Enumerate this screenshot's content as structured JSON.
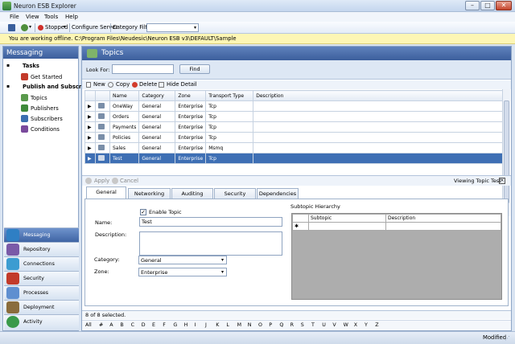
{
  "window": {
    "title": "Neuron ESB Explorer",
    "minimize": "–",
    "maximize": "□",
    "close": "✕"
  },
  "menu": [
    "File",
    "View",
    "Tools",
    "Help"
  ],
  "toolbar": {
    "status": "Stopped",
    "configure_server": "Configure Server",
    "category_filter_label": "Category Filter",
    "category_filter_value": ""
  },
  "infobar": {
    "text": "You are working offline. C:\\Program Files\\Neudesic\\Neuron ESB v3\\DEFAULT\\Sample"
  },
  "sidebar": {
    "header": "Messaging",
    "tree": [
      {
        "label": "Tasks",
        "bold": true
      },
      {
        "label": "Get Started"
      },
      {
        "label": "Publish and Subscribe",
        "bold": true
      },
      {
        "label": "Topics"
      },
      {
        "label": "Publishers"
      },
      {
        "label": "Subscribers"
      },
      {
        "label": "Conditions"
      }
    ],
    "nav": [
      {
        "label": "Messaging",
        "color": "#2f7fc4"
      },
      {
        "label": "Repository",
        "color": "#7a5aa8"
      },
      {
        "label": "Connections",
        "color": "#3c9cd1"
      },
      {
        "label": "Security",
        "color": "#c23a2a"
      },
      {
        "label": "Processes",
        "color": "#5f8fd0"
      },
      {
        "label": "Deployment",
        "color": "#8a6c3c"
      },
      {
        "label": "Activity",
        "color": "#3a9a4a"
      }
    ]
  },
  "main": {
    "header": "Topics",
    "look_for_label": "Look For:",
    "look_for_value": "",
    "find_button": "Find",
    "grid_toolbar": {
      "new": "New",
      "copy": "Copy",
      "delete": "Delete",
      "hide_detail": "Hide Detail"
    },
    "columns": [
      "Name",
      "Category",
      "Zone",
      "Transport Type",
      "Description"
    ],
    "rows": [
      {
        "name": "OneWay",
        "category": "General",
        "zone": "Enterprise",
        "transport": "Tcp",
        "description": ""
      },
      {
        "name": "Orders",
        "category": "General",
        "zone": "Enterprise",
        "transport": "Tcp",
        "description": ""
      },
      {
        "name": "Payments",
        "category": "General",
        "zone": "Enterprise",
        "transport": "Tcp",
        "description": ""
      },
      {
        "name": "Policies",
        "category": "General",
        "zone": "Enterprise",
        "transport": "Tcp",
        "description": ""
      },
      {
        "name": "Sales",
        "category": "General",
        "zone": "Enterprise",
        "transport": "Msmq",
        "description": ""
      },
      {
        "name": "Test",
        "category": "General",
        "zone": "Enterprise",
        "transport": "Tcp",
        "description": "",
        "selected": true
      }
    ],
    "detail_toolbar": {
      "apply": "Apply",
      "cancel": "Cancel",
      "viewing": "Viewing Topic Test"
    },
    "tabs": [
      "General",
      "Networking",
      "Auditing",
      "Security",
      "Dependencies"
    ],
    "form": {
      "enable_topic": "Enable Topic",
      "enable_checked": true,
      "name_label": "Name:",
      "name_value": "Test",
      "description_label": "Description:",
      "description_value": "",
      "category_label": "Category:",
      "category_value": "General",
      "zone_label": "Zone:",
      "zone_value": "Enterprise",
      "subtopic_title": "Subtopic Hierarchy",
      "subtopic_columns": [
        "Subtopic",
        "Description"
      ]
    },
    "selection_status": "8 of 8 selected.",
    "alpha": [
      "All",
      "#",
      "A",
      "B",
      "C",
      "D",
      "E",
      "F",
      "G",
      "H",
      "I",
      "J",
      "K",
      "L",
      "M",
      "N",
      "O",
      "P",
      "Q",
      "R",
      "S",
      "T",
      "U",
      "V",
      "W",
      "X",
      "Y",
      "Z"
    ]
  },
  "statusbar": {
    "text": "Modified"
  }
}
